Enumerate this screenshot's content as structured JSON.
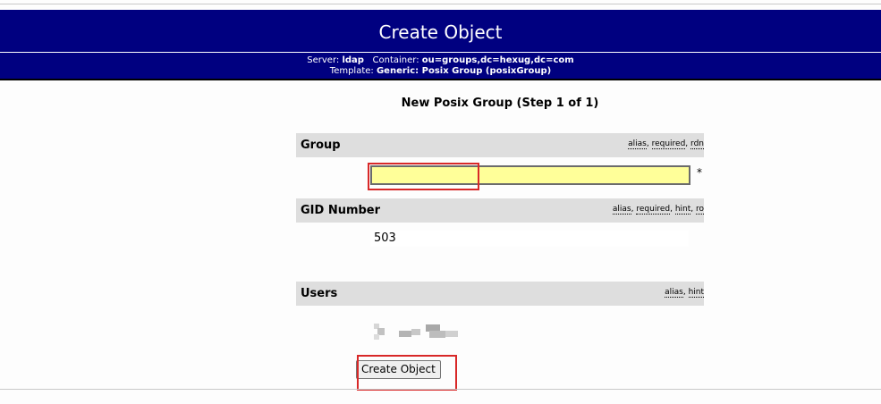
{
  "header": {
    "title": "Create Object",
    "server_label": "Server:",
    "server_value": "ldap",
    "container_label": "Container:",
    "container_value": "ou=groups,dc=hexug,dc=com",
    "template_label": "Template:",
    "template_value": "Generic: Posix Group (posixGroup)"
  },
  "form": {
    "title": "New Posix Group (Step 1 of 1)",
    "group": {
      "label": "Group",
      "hints": [
        "alias",
        "required",
        "rdn"
      ],
      "value": "",
      "required_marker": "*"
    },
    "gid": {
      "label": "GID Number",
      "hints": [
        "alias",
        "required",
        "hint",
        "ro"
      ],
      "value": "503"
    },
    "users": {
      "label": "Users",
      "hints": [
        "alias",
        "hint"
      ]
    },
    "submit_label": "Create Object"
  },
  "colors": {
    "header_bg": "#000080",
    "section_bg": "#dedede",
    "input_bg": "#ffff99",
    "highlight": "#d82828"
  }
}
